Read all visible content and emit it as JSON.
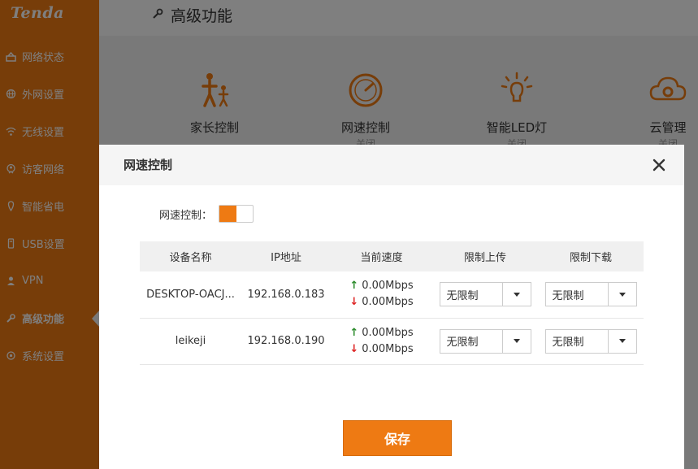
{
  "brand": {
    "logo": "Tenda"
  },
  "sidebar": {
    "items": [
      {
        "label": "网络状态",
        "icon": "network-status-icon"
      },
      {
        "label": "外网设置",
        "icon": "globe-icon"
      },
      {
        "label": "无线设置",
        "icon": "wifi-icon"
      },
      {
        "label": "访客网络",
        "icon": "guest-icon"
      },
      {
        "label": "智能省电",
        "icon": "power-save-icon"
      },
      {
        "label": "USB设置",
        "icon": "usb-icon"
      },
      {
        "label": "VPN",
        "icon": "vpn-icon"
      },
      {
        "label": "高级功能",
        "icon": "wrench-icon",
        "active": true
      },
      {
        "label": "系统设置",
        "icon": "gear-icon"
      }
    ]
  },
  "page": {
    "title": "高级功能"
  },
  "features": [
    {
      "name": "家长控制",
      "status": ""
    },
    {
      "name": "网速控制",
      "status": "关闭"
    },
    {
      "name": "智能LED灯",
      "status": "关闭"
    },
    {
      "name": "云管理",
      "status": "关闭"
    }
  ],
  "modal": {
    "title": "网速控制",
    "switch_label": "网速控制：",
    "switch_on": true,
    "columns": [
      "设备名称",
      "IP地址",
      "当前速度",
      "限制上传",
      "限制下载"
    ],
    "rows": [
      {
        "device": "DESKTOP-OACJ...",
        "ip": "192.168.0.183",
        "up": "0.00Mbps",
        "down": "0.00Mbps",
        "upload_limit": "无限制",
        "download_limit": "无限制"
      },
      {
        "device": "leikeji",
        "ip": "192.168.0.190",
        "up": "0.00Mbps",
        "down": "0.00Mbps",
        "upload_limit": "无限制",
        "download_limit": "无限制"
      }
    ],
    "save_label": "保存"
  },
  "colors": {
    "accent": "#ee7a13",
    "up_arrow": "#2a8a2a",
    "down_arrow": "#dd2222"
  }
}
